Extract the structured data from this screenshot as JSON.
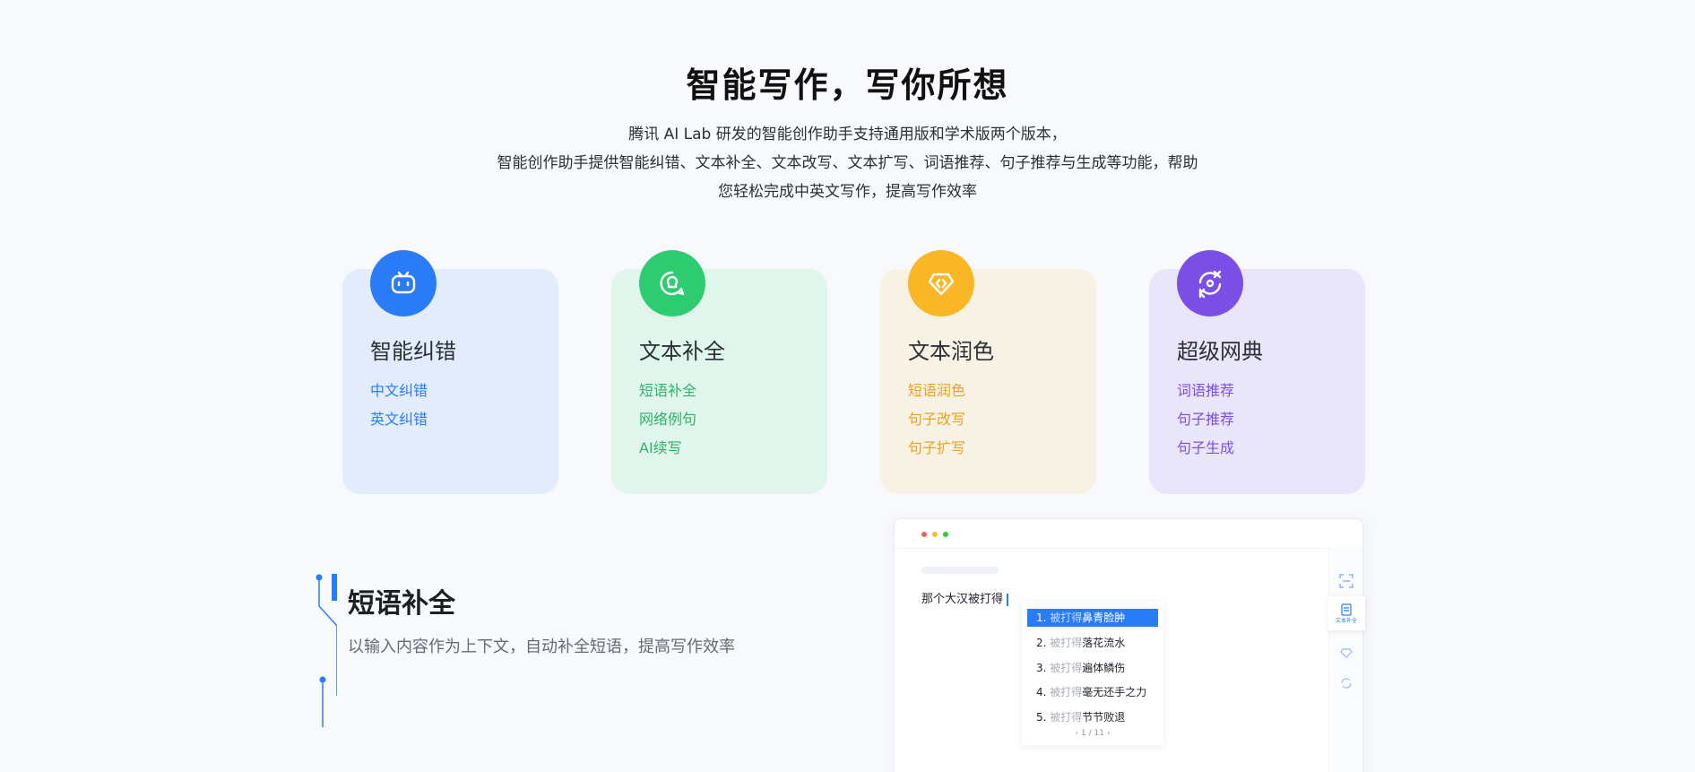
{
  "hero": {
    "title": "智能写作，写你所想",
    "desc_lines": [
      "腾讯 AI Lab 研发的智能创作助手支持通用版和学术版两个版本，",
      "智能创作助手提供智能纠错、文本补全、文本改写、文本扩写、词语推荐、句子推荐与生成等功能，帮助",
      "您轻松完成中英文写作，提高写作效率"
    ]
  },
  "cards": [
    {
      "icon": "robot-icon",
      "title": "智能纠错",
      "color": "#2a7cf6",
      "links": [
        "中文纠错",
        "英文纠错"
      ]
    },
    {
      "icon": "lightbulb-chat-icon",
      "title": "文本补全",
      "color": "#2ecc71",
      "links": [
        "短语补全",
        "网络例句",
        "AI续写"
      ]
    },
    {
      "icon": "diamond-code-icon",
      "title": "文本润色",
      "color": "#f9b625",
      "links": [
        "短语润色",
        "句子改写",
        "句子扩写"
      ]
    },
    {
      "icon": "dictionary-refresh-icon",
      "title": "超级网典",
      "color": "#7b4fe6",
      "links": [
        "词语推荐",
        "句子推荐",
        "句子生成"
      ]
    }
  ],
  "feature": {
    "title": "短语补全",
    "desc": "以输入内容作为上下文，自动补全短语，提高写作效率"
  },
  "demo": {
    "sentence": "那个大汉被打得",
    "suggestions": [
      {
        "num": "1.",
        "prefix": "被打得",
        "text": "鼻青脸肿"
      },
      {
        "num": "2.",
        "prefix": "被打得",
        "text": "落花流水"
      },
      {
        "num": "3.",
        "prefix": "被打得",
        "text": "遍体鳞伤"
      },
      {
        "num": "4.",
        "prefix": "被打得",
        "text": "毫无还手之力"
      },
      {
        "num": "5.",
        "prefix": "被打得",
        "text": "节节败退"
      }
    ],
    "pager": "1 / 11",
    "sidebar_active_label": "文本补全",
    "dot_colors": [
      "#f4605c",
      "#f9bd32",
      "#2ec840"
    ]
  }
}
